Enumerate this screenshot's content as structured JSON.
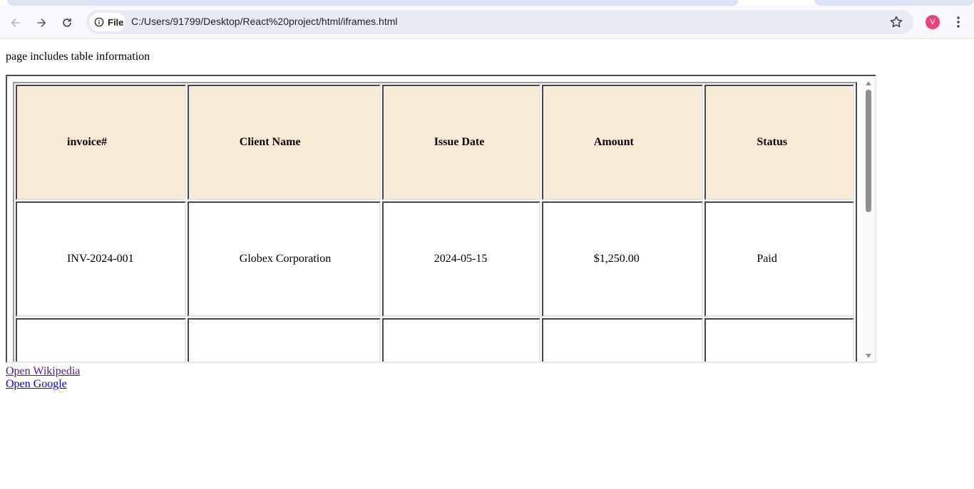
{
  "browser": {
    "chip_label": "File",
    "url": "C:/Users/91799/Desktop/React%20project/html/iframes.html",
    "avatar_letter": "V",
    "avatar_color": "#e8427a"
  },
  "page": {
    "intro": "page includes table information",
    "table": {
      "headers": [
        "invoice#",
        "Client Name",
        "Issue Date",
        "Amount",
        "Status"
      ],
      "rows": [
        [
          "INV-2024-001",
          "Globex Corporation",
          "2024-05-15",
          "$1,250.00",
          "Paid"
        ],
        [
          "",
          "",
          "",
          "",
          ""
        ]
      ],
      "header_bg": "#faebd7"
    },
    "links": [
      {
        "label": "Open Wikipedia"
      },
      {
        "label": "Open Google"
      }
    ]
  }
}
